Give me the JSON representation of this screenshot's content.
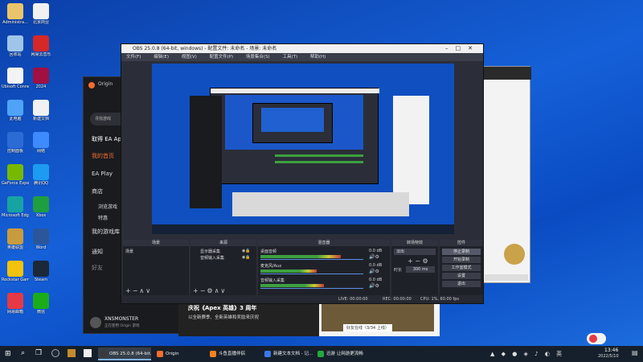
{
  "desktop": {
    "icons": [
      {
        "label": "Administra...",
        "color": "#e9c46a"
      },
      {
        "label": "北京商业",
        "color": "#f1f1f1"
      },
      {
        "label": "回收站",
        "color": "#9fc5e8"
      },
      {
        "label": "网易云音乐",
        "color": "#d62828"
      },
      {
        "label": "Ubisoft Connect",
        "color": "#f3f3f3"
      },
      {
        "label": "2024",
        "color": "#a01040"
      },
      {
        "label": "此电脑",
        "color": "#4fa3f7"
      },
      {
        "label": "新建文档",
        "color": "#f1f1f1"
      },
      {
        "label": "控制面板",
        "color": "#2b6cd4"
      },
      {
        "label": "网络",
        "color": "#3d8bfd"
      },
      {
        "label": "GeForce Experience",
        "color": "#76b900"
      },
      {
        "label": "腾讯QQ",
        "color": "#1d9bf0"
      },
      {
        "label": "Microsoft Edge",
        "color": "#18a3a3"
      },
      {
        "label": "Xbox",
        "color": "#1e9e3e"
      },
      {
        "label": "英雄联盟",
        "color": "#c89b3c"
      },
      {
        "label": "Word",
        "color": "#2b579a"
      },
      {
        "label": "Rockstar Games",
        "color": "#f4c20d"
      },
      {
        "label": "Steam",
        "color": "#1b2838"
      },
      {
        "label": "网易邮箱",
        "color": "#e63946"
      },
      {
        "label": "微信",
        "color": "#1aad19"
      }
    ]
  },
  "origin": {
    "title": "Origin",
    "search_placeholder": "寻找游戏",
    "menu": [
      "取得 EA App",
      "我的首页",
      "EA Play",
      "商店",
      "浏览游戏",
      "特惠",
      "我的游戏库",
      "通知",
      "好友"
    ],
    "username": "XNSMONSTER",
    "user_status": "正在使用 Origin 游戏"
  },
  "store": {
    "headline": "庆祝《Apex 英雄》3 周年",
    "subline": "以全新赛季、全新英雄和奖励来庆祝",
    "friend_status": "好友在线（3/34 上线）"
  },
  "obs": {
    "title": "OBS 25.0.8 (64-bit, windows) - 配置文件: 未命名 - 场景: 未命名",
    "menu": [
      "文件(F)",
      "编辑(E)",
      "视图(V)",
      "配置文件(P)",
      "场景集合(S)",
      "工具(T)",
      "帮助(H)"
    ],
    "docks": {
      "scenes": {
        "title": "场景",
        "items": [
          "场景"
        ]
      },
      "sources": {
        "title": "来源",
        "items": [
          "显示器采集",
          "音频输入采集"
        ]
      },
      "mixer": {
        "title": "混音器",
        "tracks": [
          {
            "name": "桌面音频",
            "db": "0.0 dB",
            "level": 0.78
          },
          {
            "name": "麦克风/Aux",
            "db": "0.0 dB",
            "level": 0.55
          },
          {
            "name": "音频输入采集",
            "db": "0.0 dB",
            "level": 0.62
          }
        ]
      },
      "transitions": {
        "title": "转场特效",
        "type": "淡出",
        "duration_label": "时长",
        "duration": "300 ms"
      },
      "controls": {
        "title": "控件",
        "buttons": [
          "停止录制",
          "开始录制",
          "工作室模式",
          "设置",
          "退出"
        ]
      }
    },
    "status": {
      "live": "LIVE: 00:00:00",
      "rec": "REC: 00:00:00",
      "cpu": "CPU: 1%, 60.00 fps"
    }
  },
  "taskbar": {
    "items": [
      {
        "label": "OBS 25.0.8 (64-bit...",
        "color": "#3a3a3a",
        "active": true
      },
      {
        "label": "Origin",
        "color": "#f56c2d",
        "active": false
      },
      {
        "label": "斗鱼直播伴侣",
        "color": "#f58220",
        "active": false
      },
      {
        "label": "新建文本文档 - 记...",
        "color": "#3b78e7",
        "active": false
      },
      {
        "label": "迅游 让网游更流畅",
        "color": "#22a83a",
        "active": false
      }
    ],
    "time": "13:46",
    "date": "2022/5/10"
  }
}
